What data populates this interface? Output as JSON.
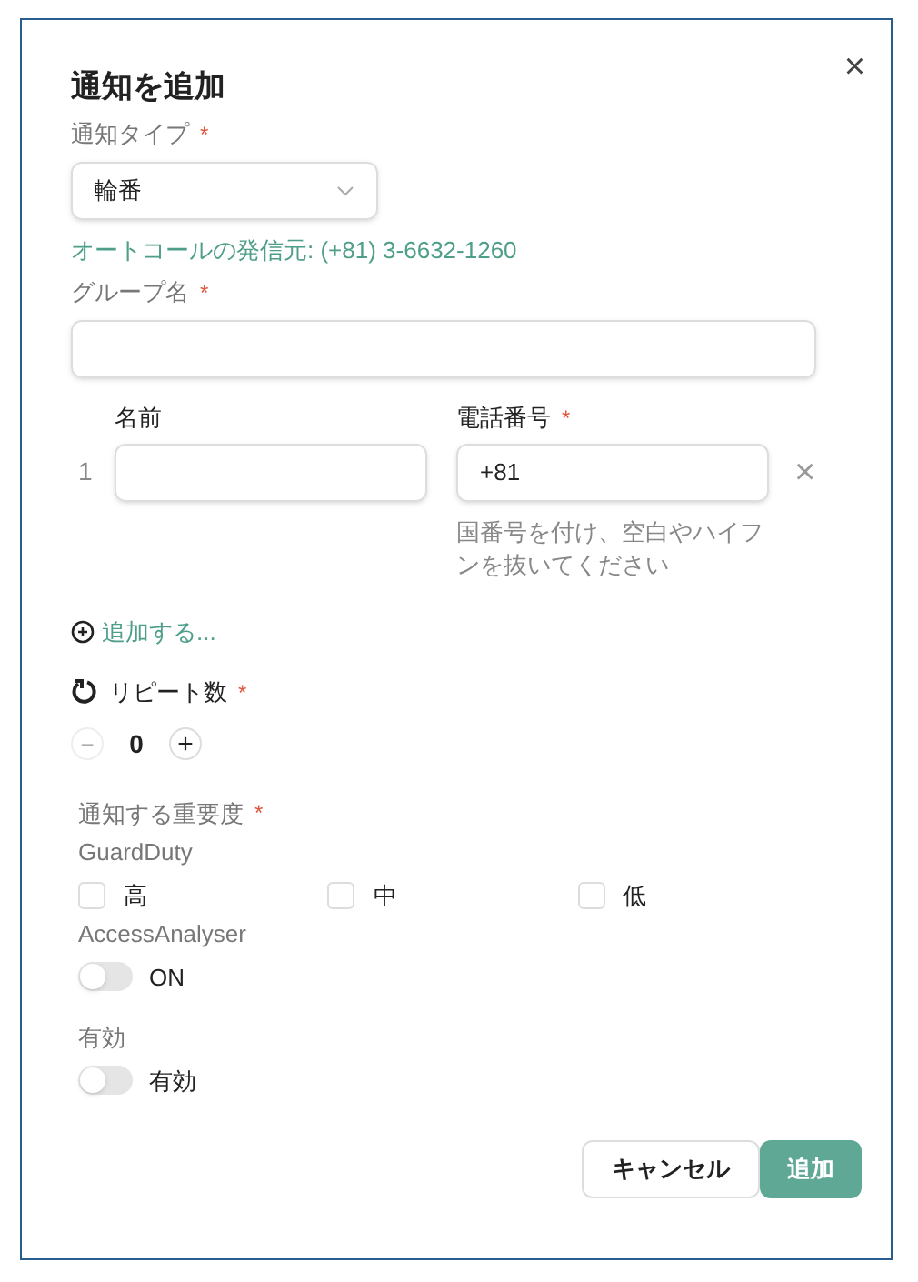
{
  "dialog": {
    "title": "通知を追加",
    "close": "×"
  },
  "notification_type": {
    "label": "通知タイプ",
    "required_mark": "*",
    "value": "輪番"
  },
  "caller_info": "オートコールの発信元: (+81) 3-6632-1260",
  "group_name": {
    "label": "グループ名",
    "required_mark": "*"
  },
  "contacts": {
    "name_label": "名前",
    "phone_label": "電話番号",
    "phone_required_mark": "*",
    "rows": [
      {
        "index": "1",
        "phone": "+81",
        "remove": "×"
      }
    ],
    "phone_help": "国番号を付け、空白やハイフンを抜いてください"
  },
  "add_link": "追加する...",
  "repeat": {
    "label": "リピート数",
    "required_mark": "*",
    "minus": "−",
    "value": "0",
    "plus": "+"
  },
  "severity": {
    "label": "通知する重要度",
    "required_mark": "*",
    "groups": [
      {
        "name": "GuardDuty",
        "kind": "checkboxes",
        "options": [
          {
            "label": "高",
            "checked": false
          },
          {
            "label": "中",
            "checked": false
          },
          {
            "label": "低",
            "checked": false
          }
        ]
      },
      {
        "name": "AccessAnalyser",
        "kind": "toggle",
        "toggle": {
          "label": "ON",
          "on": false
        }
      }
    ]
  },
  "enabled": {
    "label": "有効",
    "toggle": {
      "label": "有効",
      "on": false
    }
  },
  "buttons": [
    {
      "label": "キャンセル",
      "kind": "secondary"
    },
    {
      "label": "追加",
      "kind": "primary"
    }
  ]
}
